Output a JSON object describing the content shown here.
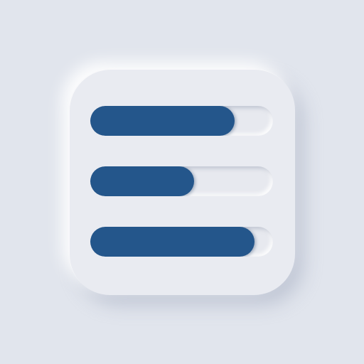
{
  "icon": {
    "name": "equalizer-sliders-icon",
    "background_color": "#e1e5ed",
    "accent_color": "#24568b"
  },
  "sliders": [
    {
      "value": 0.79
    },
    {
      "value": 0.57
    },
    {
      "value": 0.9
    }
  ]
}
